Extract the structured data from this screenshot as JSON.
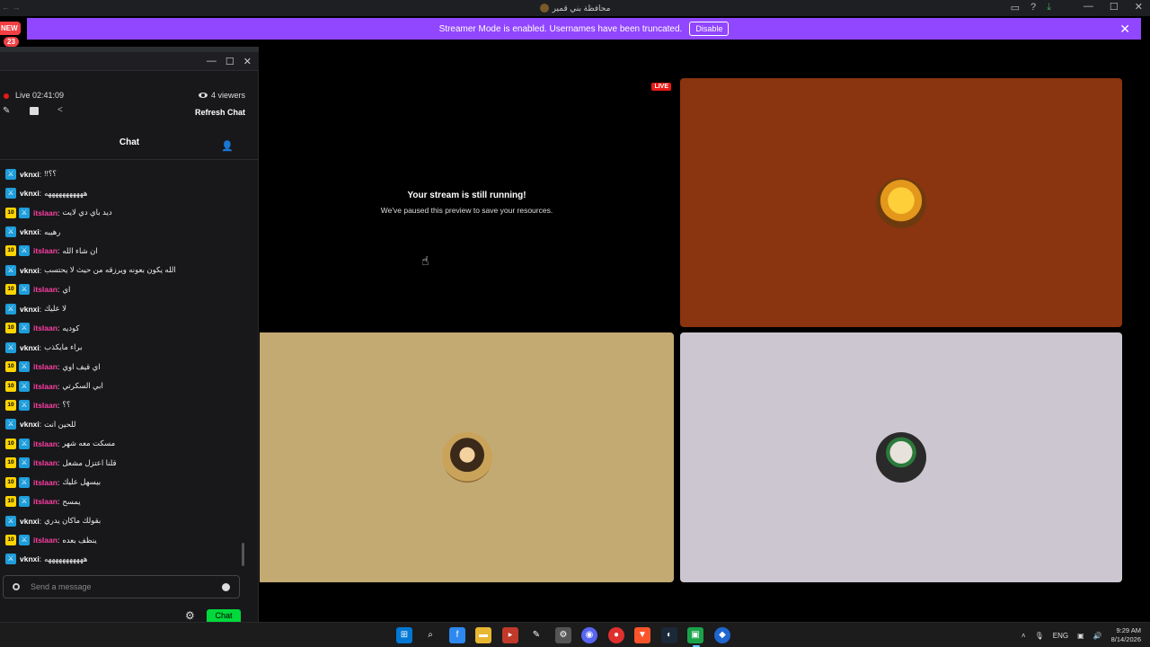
{
  "titlebar": {
    "title": "محافظة بني قمير"
  },
  "banner": {
    "text": "Streamer Mode is enabled. Usernames have been truncated.",
    "disable_label": "Disable"
  },
  "badges": {
    "new": "NEW",
    "count": "23"
  },
  "chat_window": {
    "live_time": "Live 02:41:09",
    "viewers": "4 viewers",
    "refresh_label": "Refresh Chat",
    "header_title": "Chat",
    "input_placeholder": "Send a message",
    "chat_button": "Chat",
    "messages": [
      {
        "user": "vknxi",
        "sub": "",
        "text": "!!؟؟"
      },
      {
        "user": "vknxi",
        "sub": "",
        "text": "هههههههههههه"
      },
      {
        "user": "itslaan",
        "sub": "10",
        "text": "ديد باي دي لايت"
      },
      {
        "user": "vknxi",
        "sub": "",
        "text": "رهيبه"
      },
      {
        "user": "itslaan",
        "sub": "10",
        "text": "ان شاء الله"
      },
      {
        "user": "vknxi",
        "sub": "",
        "text": "الله يكون بعونه ويرزقه من حيث لا يحتسب"
      },
      {
        "user": "itslaan",
        "sub": "10",
        "text": "اي"
      },
      {
        "user": "vknxi",
        "sub": "",
        "text": "لا عليك"
      },
      {
        "user": "itslaan",
        "sub": "10",
        "text": "كوديه"
      },
      {
        "user": "vknxi",
        "sub": "",
        "text": "براء مايكذب"
      },
      {
        "user": "itslaan",
        "sub": "10",
        "text": "اي قيف اوي"
      },
      {
        "user": "itslaan",
        "sub": "10",
        "text": "ابي السكرتي"
      },
      {
        "user": "itslaan",
        "sub": "10",
        "text": "؟؟"
      },
      {
        "user": "vknxi",
        "sub": "",
        "text": "للحين انت"
      },
      {
        "user": "itslaan",
        "sub": "10",
        "text": "مسكت معه شهر"
      },
      {
        "user": "itslaan",
        "sub": "10",
        "text": "قلنا اعتزل مشعل"
      },
      {
        "user": "itslaan",
        "sub": "10",
        "text": "بيسهل عليك"
      },
      {
        "user": "itslaan",
        "sub": "10",
        "text": "يمسح"
      },
      {
        "user": "vknxi",
        "sub": "",
        "text": "بقولك ماكان يدري"
      },
      {
        "user": "itslaan",
        "sub": "10",
        "text": "ينظف بعده"
      },
      {
        "user": "vknxi",
        "sub": "",
        "text": "هههههههههههه"
      }
    ]
  },
  "stream": {
    "live_tag": "LIVE",
    "paused_title": "Your stream is still running!",
    "paused_subtitle": "We've paused this preview to save your resources."
  },
  "taskbar": {
    "lang": "ENG",
    "time": "9:29 AM",
    "date": "8/14/2026"
  },
  "colors": {
    "banner": "#9146ff",
    "live": "#e91916",
    "chat_button": "#00d93c",
    "username_pink": "#ff3fa4"
  }
}
